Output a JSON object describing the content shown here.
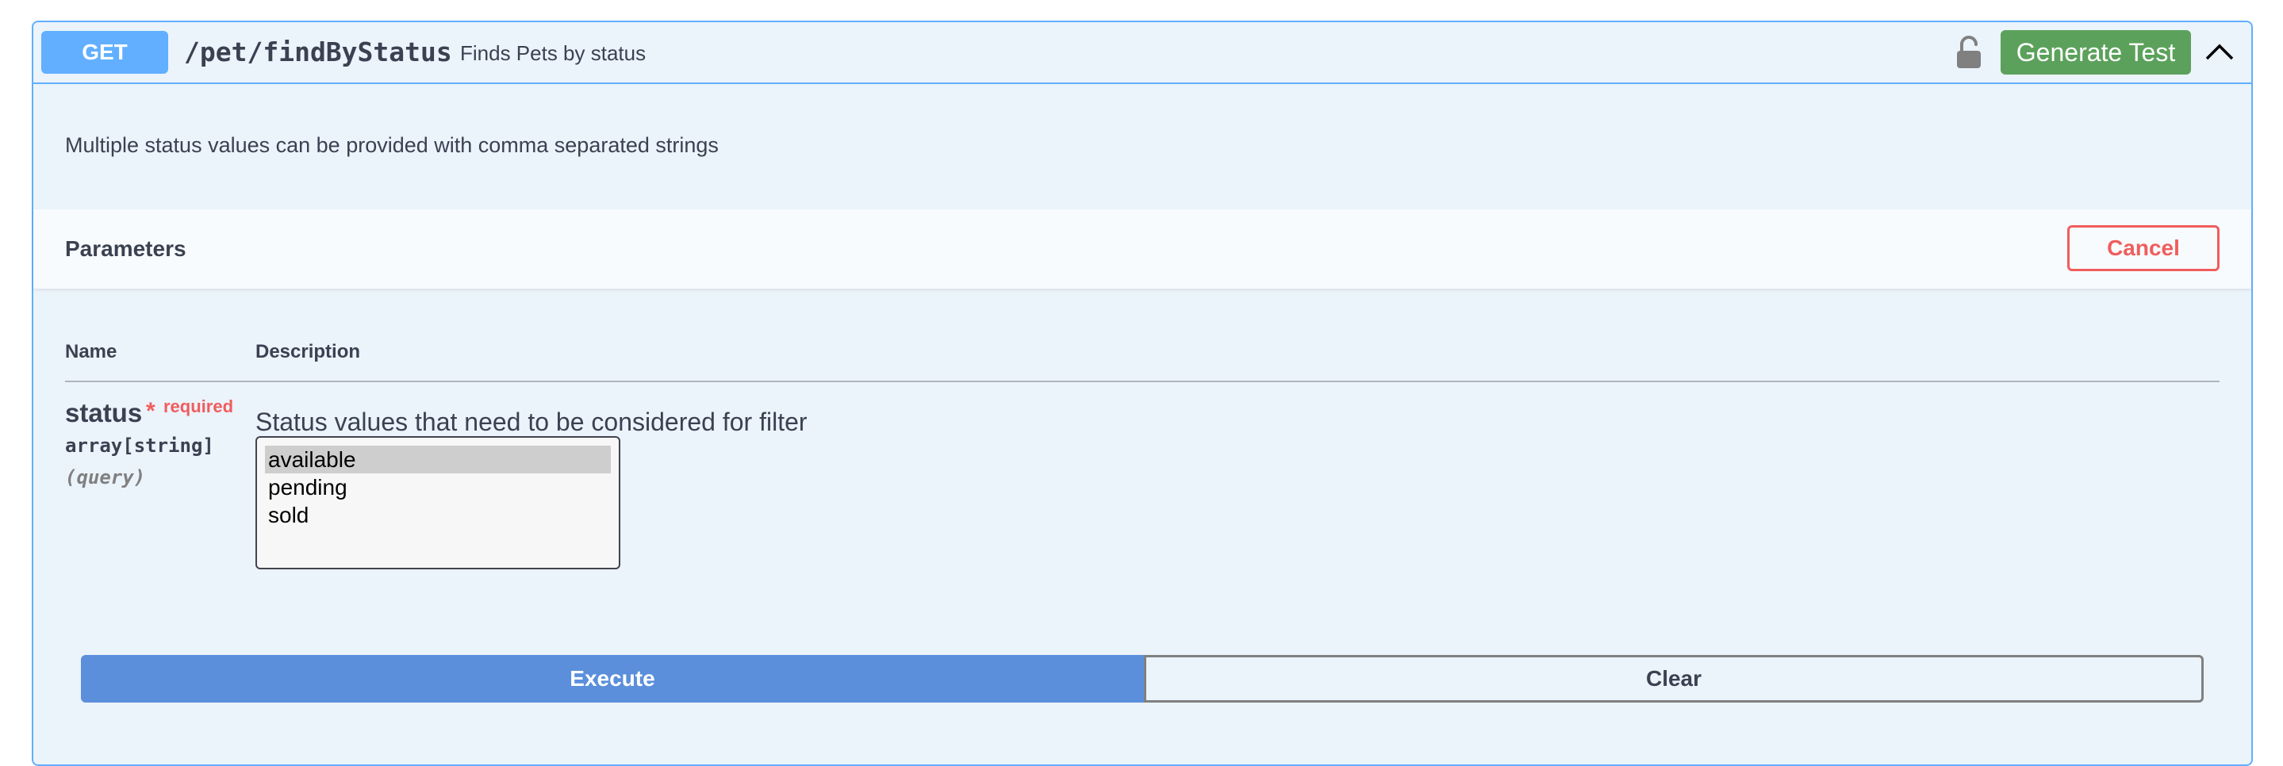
{
  "operation": {
    "method": "GET",
    "path": "/pet/findByStatus",
    "summary": "Finds Pets by status",
    "description": "Multiple status values can be provided with comma separated strings",
    "generate_test_label": "Generate Test",
    "lock_icon": "unlock-icon",
    "collapse_icon": "chevron-up-icon"
  },
  "parameters": {
    "title": "Parameters",
    "cancel_label": "Cancel",
    "columns": {
      "name": "Name",
      "description": "Description"
    },
    "items": [
      {
        "name": "status",
        "required_mark": "*",
        "required_label": "required",
        "type": "array[string]",
        "in": "(query)",
        "description": "Status values that need to be considered for filter",
        "options": [
          "available",
          "pending",
          "sold"
        ],
        "selected": "available"
      }
    ]
  },
  "actions": {
    "execute_label": "Execute",
    "clear_label": "Clear"
  },
  "colors": {
    "method_bg": "#61affe",
    "generate_bg": "#5ba15b",
    "cancel": "#f05d5d",
    "execute_bg": "#5b8fdc"
  }
}
